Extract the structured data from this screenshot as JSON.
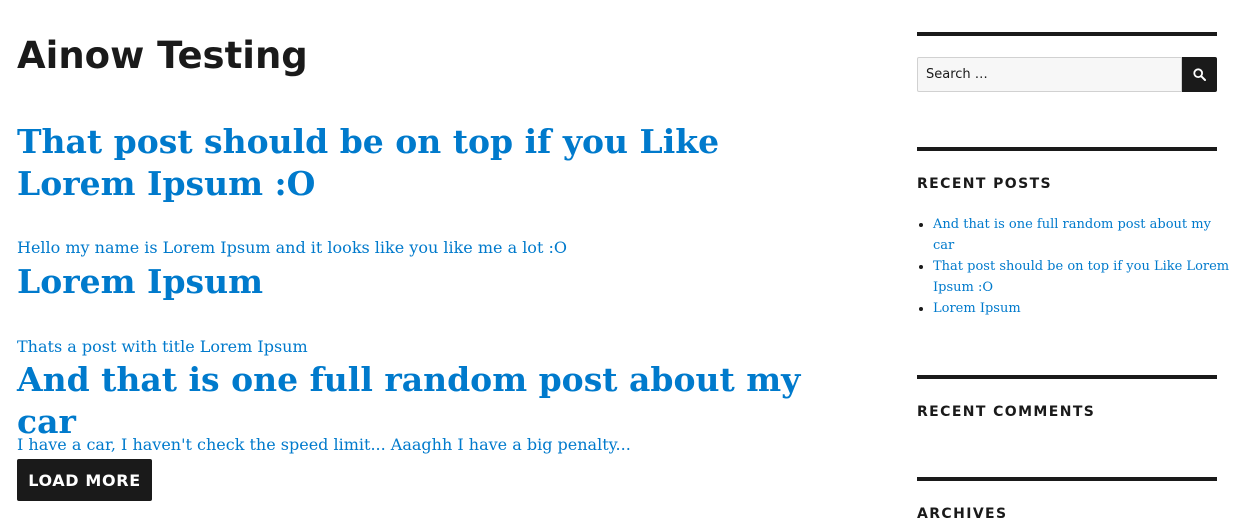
{
  "site": {
    "title": "Ainow Testing"
  },
  "posts": [
    {
      "title": "That post should be on top if you Like Lorem Ipsum :O",
      "excerpt": "Hello my name is Lorem Ipsum and it looks like you like me a lot :O"
    },
    {
      "title": "Lorem Ipsum",
      "excerpt": "Thats a post with title Lorem Ipsum"
    },
    {
      "title": "And that is one full random post about my car",
      "excerpt": "I have a car, I haven't check the speed limit... Aaaghh I have a big penalty..."
    }
  ],
  "load_more": {
    "label": "LOAD MORE"
  },
  "sidebar": {
    "search": {
      "placeholder": "Search …",
      "icon": "search-icon"
    },
    "recent_posts": {
      "title": "RECENT POSTS",
      "items": [
        "And that is one full random post about my car",
        "That post should be on top if you Like Lorem Ipsum :O",
        "Lorem Ipsum"
      ]
    },
    "recent_comments": {
      "title": "RECENT COMMENTS"
    },
    "archives": {
      "title": "ARCHIVES"
    }
  },
  "colors": {
    "link": "#007acc",
    "text": "#1a1a1a",
    "rule": "#1a1a1a"
  }
}
